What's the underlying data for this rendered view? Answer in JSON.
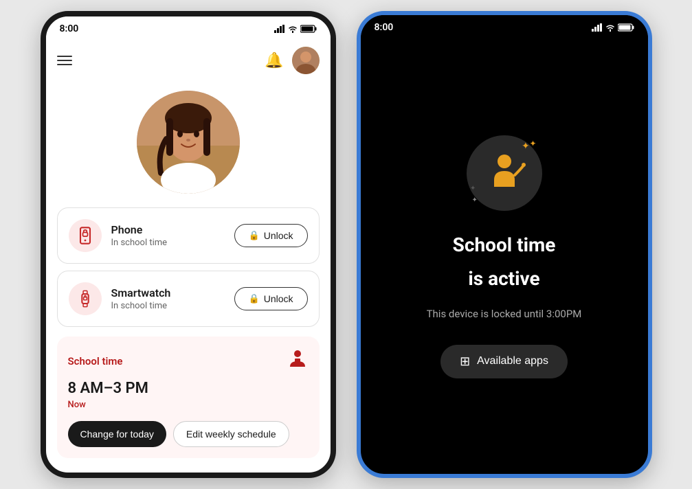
{
  "left_phone": {
    "status_bar": {
      "time": "8:00"
    },
    "devices": [
      {
        "name": "Phone",
        "status": "In school time",
        "icon": "📱",
        "unlock_label": "Unlock"
      },
      {
        "name": "Smartwatch",
        "status": "In school time",
        "icon": "⌚",
        "unlock_label": "Unlock"
      }
    ],
    "school_time": {
      "label": "School time",
      "hours": "8 AM–3 PM",
      "now": "Now",
      "change_today": "Change for today",
      "edit_schedule": "Edit weekly schedule"
    }
  },
  "right_phone": {
    "status_bar": {
      "time": "8:00"
    },
    "title_line1": "School time",
    "title_line2": "is active",
    "subtitle": "This device is locked until 3:00PM",
    "available_apps_label": "Available apps"
  }
}
